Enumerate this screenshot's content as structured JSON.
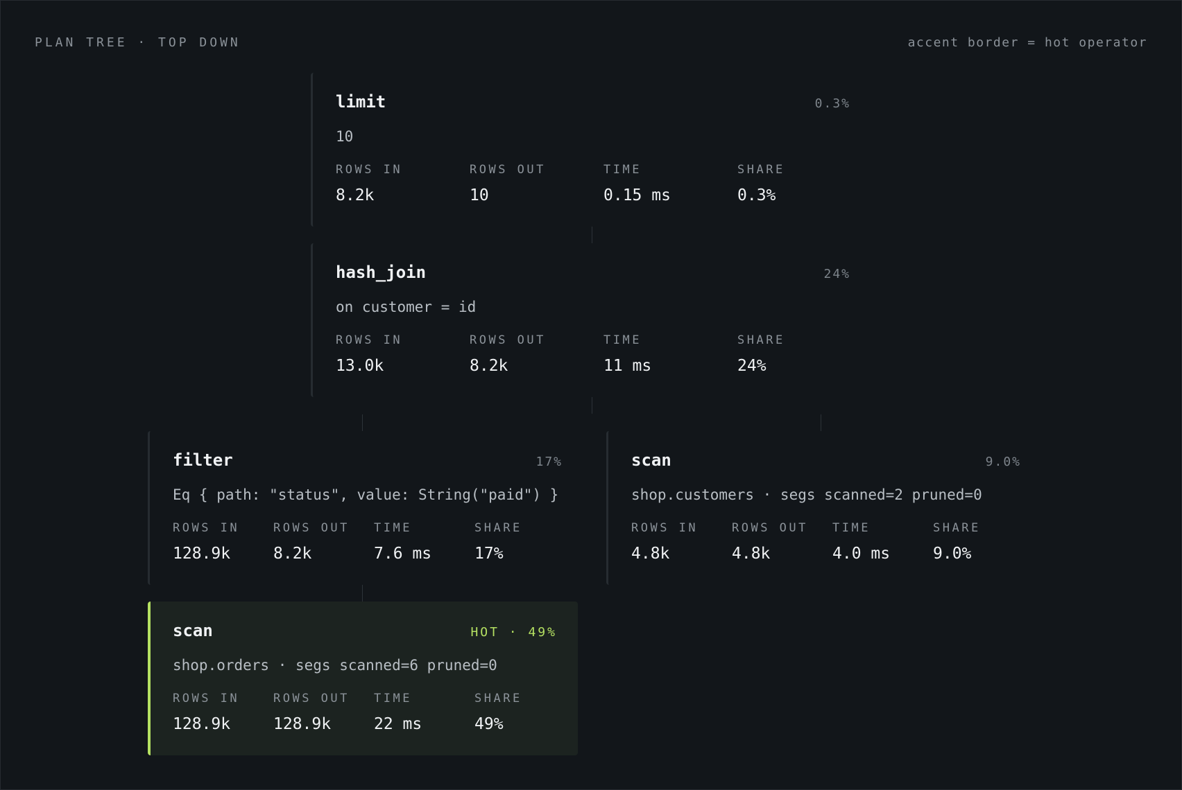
{
  "header": {
    "title": "PLAN TREE · TOP DOWN",
    "legend": "accent border = hot operator"
  },
  "stat_labels": {
    "rows_in": "ROWS IN",
    "rows_out": "ROWS OUT",
    "time": "TIME",
    "share": "SHARE"
  },
  "nodes": [
    {
      "op": "limit",
      "badge": "0.3%",
      "detail": "10",
      "rows_in": "8.2k",
      "rows_out": "10",
      "time": "0.15 ms",
      "share": "0.3%",
      "hot": false
    },
    {
      "op": "hash_join",
      "badge": "24%",
      "detail": "on customer = id",
      "rows_in": "13.0k",
      "rows_out": "8.2k",
      "time": "11 ms",
      "share": "24%",
      "hot": false
    },
    {
      "op": "filter",
      "badge": "17%",
      "detail": "Eq { path: \"status\", value: String(\"paid\") }",
      "rows_in": "128.9k",
      "rows_out": "8.2k",
      "time": "7.6 ms",
      "share": "17%",
      "hot": false
    },
    {
      "op": "scan",
      "badge": "9.0%",
      "detail": "shop.customers · segs scanned=2 pruned=0",
      "rows_in": "4.8k",
      "rows_out": "4.8k",
      "time": "4.0 ms",
      "share": "9.0%",
      "hot": false
    },
    {
      "op": "scan",
      "badge": "HOT · 49%",
      "detail": "shop.orders · segs scanned=6 pruned=0",
      "rows_in": "128.9k",
      "rows_out": "128.9k",
      "time": "22 ms",
      "share": "49%",
      "hot": true
    }
  ],
  "colors": {
    "accent": "#b5e162",
    "background": "#12161a",
    "hot_background": "#1c2320"
  }
}
